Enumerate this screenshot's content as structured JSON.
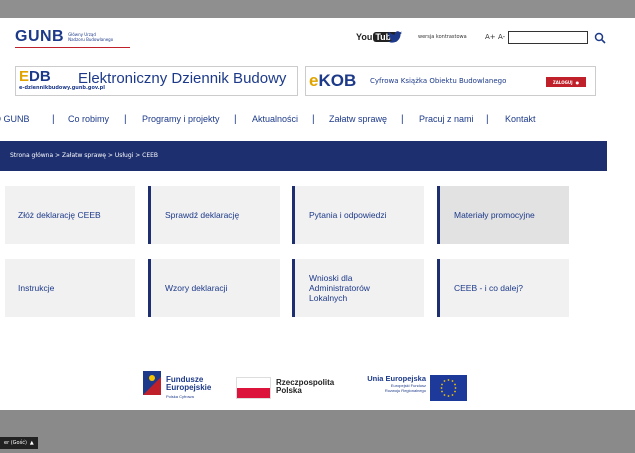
{
  "header": {
    "logo_text": "GUNB",
    "logo_sub_1": "Główny Urząd",
    "logo_sub_2": "Nadzoru Budowlanego",
    "youtube_you": "You",
    "youtube_tube": "Tube",
    "wersja": "wersja kontrastowa",
    "font_plus": "A+",
    "font_minus": "A-",
    "search_placeholder": ""
  },
  "edb": {
    "logo_e": "E",
    "logo_db": "DB",
    "url": "e-dziennikbudowy.gunb.gov.pl",
    "title": "Elektroniczny Dziennik Budowy"
  },
  "ekob": {
    "logo_e": "e",
    "logo_kob": "KOB",
    "title": "Cyfrowa Książka Obiektu Budowlanego",
    "login": "ZALOGUJ"
  },
  "nav": {
    "items": [
      "O GUNB",
      "Co robimy",
      "Programy i projekty",
      "Aktualności",
      "Załatw sprawę",
      "Pracuj z nami",
      "Kontakt"
    ]
  },
  "breadcrumb": "Strona główna > Załatw sprawę > Usługi > CEEB",
  "tiles": [
    "Złóż deklarację CEEB",
    "Sprawdź deklarację",
    "Pytania i odpowiedzi",
    "Materiały promocyjne",
    "Instrukcje",
    "Wzory deklaracji",
    "Wnioski dla Administratorów Lokalnych",
    "CEEB - i co dalej?"
  ],
  "footer_logos": {
    "fe_line1": "Fundusze",
    "fe_line2": "Europejskie",
    "fe_line3": "Polska Cyfrowa",
    "rp_line1": "Rzeczpospolita",
    "rp_line2": "Polska",
    "ue_line1": "Unia Europejska",
    "ue_line2": "Europejski Fundusz",
    "ue_line3": "Rozwoju Regionalnego"
  },
  "status_bar": "er (Gość)",
  "colors": {
    "brand_blue": "#1d3a8a",
    "dark_navy": "#1d2f6f",
    "accent_red": "#c0202a",
    "accent_yellow": "#e0a300"
  }
}
